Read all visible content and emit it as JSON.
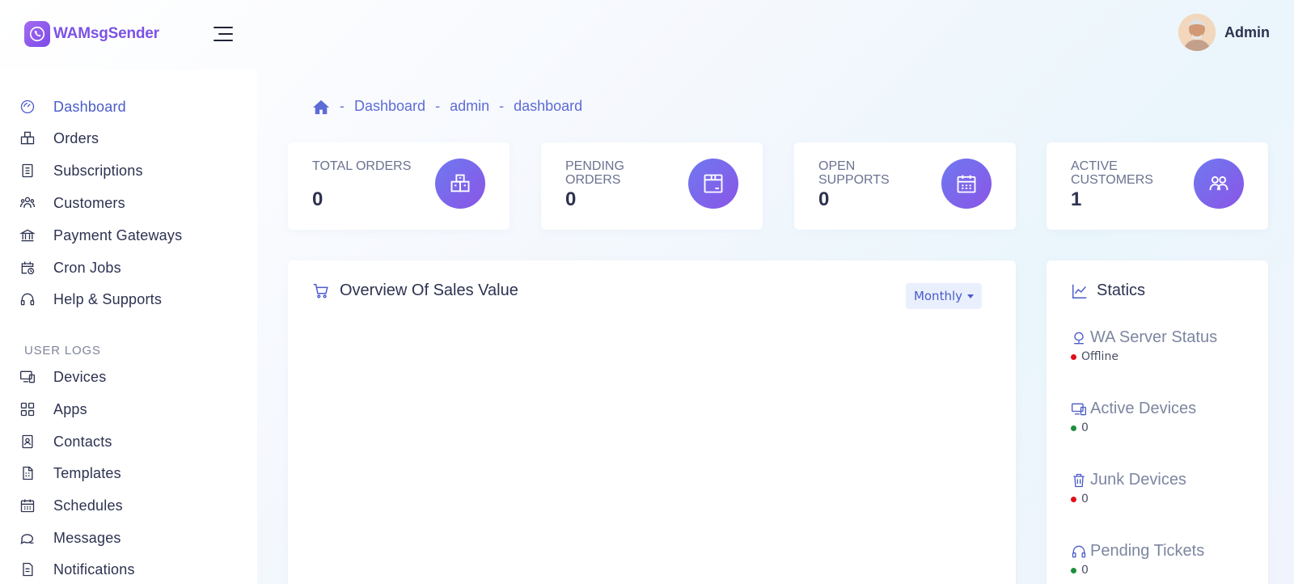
{
  "app": {
    "name": "WAMsgSender"
  },
  "user": {
    "name": "Admin"
  },
  "sidebar": {
    "items": [
      {
        "label": "Dashboard",
        "icon": "gauge-icon"
      },
      {
        "label": "Orders",
        "icon": "boxes-icon"
      },
      {
        "label": "Subscriptions",
        "icon": "receipt-icon"
      },
      {
        "label": "Customers",
        "icon": "users-icon"
      },
      {
        "label": "Payment Gateways",
        "icon": "bank-icon"
      },
      {
        "label": "Cron Jobs",
        "icon": "calendar-clock-icon"
      },
      {
        "label": "Help & Supports",
        "icon": "headset-icon"
      }
    ],
    "section_title": "USER LOGS",
    "log_items": [
      {
        "label": "Devices",
        "icon": "devices-icon"
      },
      {
        "label": "Apps",
        "icon": "apps-grid-icon"
      },
      {
        "label": "Contacts",
        "icon": "contact-book-icon"
      },
      {
        "label": "Templates",
        "icon": "template-icon"
      },
      {
        "label": "Schedules",
        "icon": "calendar-icon"
      },
      {
        "label": "Messages",
        "icon": "messages-icon"
      },
      {
        "label": "Notifications",
        "icon": "notification-icon"
      }
    ]
  },
  "breadcrumb": [
    "Dashboard",
    "admin",
    "dashboard"
  ],
  "stats": [
    {
      "label": "TOTAL ORDERS",
      "value": "0"
    },
    {
      "label": "PENDING ORDERS",
      "value": "0"
    },
    {
      "label": "OPEN SUPPORTS",
      "value": "0"
    },
    {
      "label": "ACTIVE CUSTOMERS",
      "value": "1"
    }
  ],
  "sales_panel": {
    "title": "Overview Of Sales Value",
    "period": "Monthly"
  },
  "statics": {
    "title": "Statics",
    "items": [
      {
        "label": "WA Server Status",
        "value": "Offline",
        "status_color": "#e0101a"
      },
      {
        "label": "Active Devices",
        "value": "0",
        "status_color": "#1a8f3c"
      },
      {
        "label": "Junk Devices",
        "value": "0",
        "status_color": "#e0101a"
      },
      {
        "label": "Pending Tickets",
        "value": "0",
        "status_color": "#1a8f3c"
      }
    ]
  },
  "colors": {
    "accent": "#4a5bc9",
    "brand": "#7b52e6",
    "icon_gradient_start": "#6f79f0",
    "icon_gradient_end": "#8a55e6"
  }
}
